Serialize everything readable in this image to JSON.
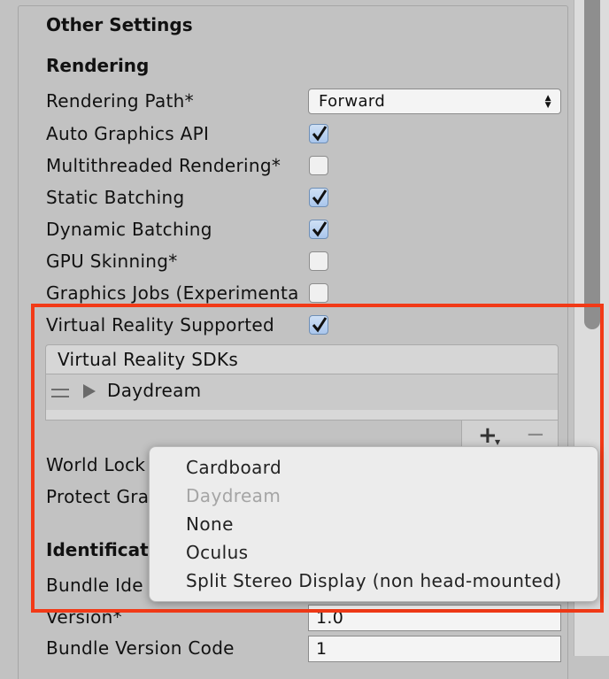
{
  "section": {
    "title": "Other Settings",
    "rendering_heading": "Rendering",
    "identification_heading": "Identificat"
  },
  "rendering": {
    "rendering_path_label": "Rendering Path*",
    "rendering_path_value": "Forward",
    "auto_graphics_api_label": "Auto Graphics API",
    "auto_graphics_api_checked": true,
    "multithreaded_label": "Multithreaded Rendering*",
    "multithreaded_checked": false,
    "static_batching_label": "Static Batching",
    "static_batching_checked": true,
    "dynamic_batching_label": "Dynamic Batching",
    "dynamic_batching_checked": true,
    "gpu_skinning_label": "GPU Skinning*",
    "gpu_skinning_checked": false,
    "graphics_jobs_label": "Graphics Jobs (Experimenta",
    "graphics_jobs_checked": false,
    "vr_supported_label": "Virtual Reality Supported",
    "vr_supported_checked": true
  },
  "vr_sdks": {
    "header": "Virtual Reality SDKs",
    "items": [
      "Daydream"
    ],
    "add_label": "+",
    "remove_label": "−"
  },
  "other_rows": {
    "world_lock_label": "World Lock",
    "protect_graphics_label": "Protect Gra",
    "bundle_identifier_label": "Bundle Ide",
    "version_label": "Version*",
    "version_value": "1.0",
    "bundle_version_code_label": "Bundle Version Code",
    "bundle_version_code_value": "1"
  },
  "popup_menu": {
    "items": [
      {
        "label": "Cardboard",
        "disabled": false
      },
      {
        "label": "Daydream",
        "disabled": true
      },
      {
        "label": "None",
        "disabled": false
      },
      {
        "label": "Oculus",
        "disabled": false
      },
      {
        "label": "Split Stereo Display (non head-mounted)",
        "disabled": false
      }
    ]
  },
  "colors": {
    "highlight": "#f23a17",
    "panel_bg": "#c2c2c2",
    "checkbox_checked": "#a9c6ec"
  }
}
